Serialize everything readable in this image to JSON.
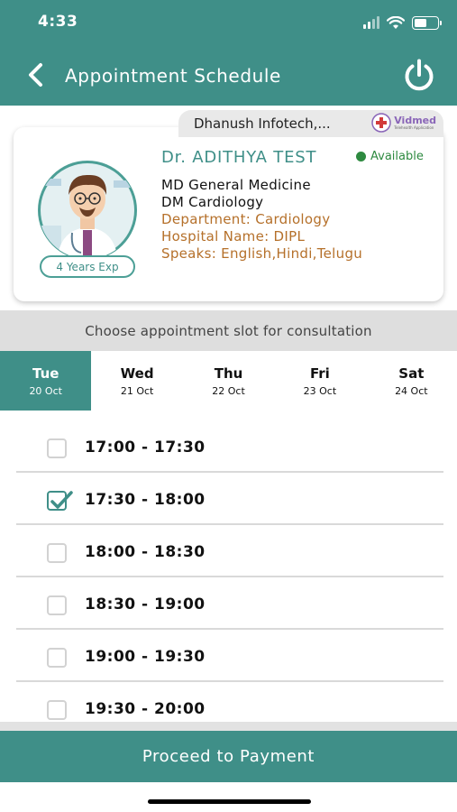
{
  "status_bar": {
    "time": "4:33"
  },
  "header": {
    "title": "Appointment Schedule"
  },
  "organization": {
    "name": "Dhanush Infotech,...",
    "logo_text": "Vidmed",
    "logo_subtext": "Telehealth Application"
  },
  "doctor": {
    "name": "Dr. ADITHYA TEST",
    "availability": "Available",
    "qualification_1": "MD General Medicine",
    "qualification_2": "DM Cardiology",
    "department": "Department: Cardiology",
    "hospital": "Hospital Name: DIPL",
    "languages": "Speaks: English,Hindi,Telugu",
    "experience": "4 Years Exp"
  },
  "slot_prompt": "Choose appointment slot for consultation",
  "days": [
    {
      "day": "Tue",
      "date": "20 Oct",
      "active": true
    },
    {
      "day": "Wed",
      "date": "21 Oct",
      "active": false
    },
    {
      "day": "Thu",
      "date": "22 Oct",
      "active": false
    },
    {
      "day": "Fri",
      "date": "23 Oct",
      "active": false
    },
    {
      "day": "Sat",
      "date": "24 Oct",
      "active": false
    }
  ],
  "slots": [
    {
      "label": "17:00 - 17:30",
      "checked": false
    },
    {
      "label": "17:30 - 18:00",
      "checked": true
    },
    {
      "label": "18:00 - 18:30",
      "checked": false
    },
    {
      "label": "18:30 - 19:00",
      "checked": false
    },
    {
      "label": "19:00 - 19:30",
      "checked": false
    },
    {
      "label": "19:30 - 20:00",
      "checked": false
    }
  ],
  "proceed_label": "Proceed to Payment",
  "colors": {
    "primary": "#3f8f88",
    "available": "#2e8a40",
    "detail": "#b5702a"
  },
  "icons": {
    "back": "chevron-left-icon",
    "power": "power-icon",
    "available": "green-dot-icon",
    "checked": "checkmark-icon"
  }
}
